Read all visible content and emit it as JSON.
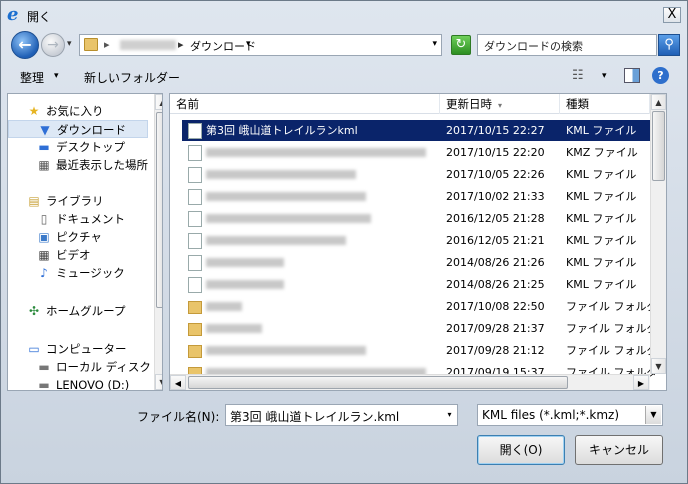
{
  "window": {
    "title": "開く",
    "close_glyph": "X",
    "title_icon_glyph": "e"
  },
  "address": {
    "segment_root_arrow": "▸",
    "segment_current": "ダウンロード",
    "segment_current_arrow": "▾",
    "dropdown_glyph": "▾"
  },
  "search": {
    "placeholder": "ダウンロードの検索"
  },
  "toolbar": {
    "organize_label": "整理",
    "organize_dd": "▾",
    "new_folder_label": "新しいフォルダー",
    "view_dd": "▾",
    "help_glyph": "?"
  },
  "nav": {
    "items": [
      {
        "label": "お気に入り",
        "icon": "star-icon",
        "glyph": "★",
        "color": "#e6b422"
      },
      {
        "label": "ダウンロード",
        "icon": "download-folder-icon",
        "glyph": "▼",
        "color": "#2f6fd6"
      },
      {
        "label": "デスクトップ",
        "icon": "desktop-icon",
        "glyph": "▬",
        "color": "#2f6fd6"
      },
      {
        "label": "最近表示した場所",
        "icon": "recent-places-icon",
        "glyph": "▦",
        "color": "#555"
      },
      {
        "label": "ライブラリ",
        "icon": "library-icon",
        "glyph": "▤",
        "color": "#c9a23a"
      },
      {
        "label": "ドキュメント",
        "icon": "documents-icon",
        "glyph": "▯",
        "color": "#666"
      },
      {
        "label": "ピクチャ",
        "icon": "pictures-icon",
        "glyph": "▣",
        "color": "#3b7ac9"
      },
      {
        "label": "ビデオ",
        "icon": "videos-icon",
        "glyph": "▦",
        "color": "#444"
      },
      {
        "label": "ミュージック",
        "icon": "music-icon",
        "glyph": "♪",
        "color": "#2f6fd6"
      },
      {
        "label": "ホームグループ",
        "icon": "homegroup-icon",
        "glyph": "✣",
        "color": "#2a8a3c"
      },
      {
        "label": "コンピューター",
        "icon": "computer-icon",
        "glyph": "▭",
        "color": "#2f6fd6"
      },
      {
        "label": "ローカル ディスク (C",
        "icon": "local-disk-icon",
        "glyph": "▬",
        "color": "#777"
      },
      {
        "label": "LENOVO (D:)",
        "icon": "drive-icon",
        "glyph": "▬",
        "color": "#777"
      }
    ]
  },
  "files": {
    "columns": {
      "name": "名前",
      "date": "更新日時",
      "type": "種類",
      "sort_arrow": "▾"
    },
    "rows": [
      {
        "name": "第3回 峨山道トレイルランkml",
        "date": "2017/10/15 22:27",
        "type": "KML ファイル"
      },
      {
        "name": "",
        "date": "2017/10/15 22:20",
        "type": "KMZ ファイル"
      },
      {
        "name": "",
        "date": "2017/10/05 22:26",
        "type": "KML ファイル"
      },
      {
        "name": "",
        "date": "2017/10/02 21:33",
        "type": "KML ファイル"
      },
      {
        "name": "",
        "date": "2016/12/05 21:28",
        "type": "KML ファイル"
      },
      {
        "name": "",
        "date": "2016/12/05 21:21",
        "type": "KML ファイル"
      },
      {
        "name": "",
        "date": "2014/08/26 21:26",
        "type": "KML ファイル"
      },
      {
        "name": "",
        "date": "2014/08/26 21:25",
        "type": "KML ファイル"
      },
      {
        "name": "",
        "date": "2017/10/08 22:50",
        "type": "ファイル フォルダー"
      },
      {
        "name": "",
        "date": "2017/09/28 21:37",
        "type": "ファイル フォルダー"
      },
      {
        "name": "",
        "date": "2017/09/28 21:12",
        "type": "ファイル フォルダー"
      },
      {
        "name": "",
        "date": "2017/09/19 15:37",
        "type": "ファイル フォルダー"
      }
    ]
  },
  "scroll": {
    "up": "▲",
    "down": "▼",
    "left": "◀",
    "right": "▶"
  },
  "bottom": {
    "filename_label": "ファイル名(N):",
    "filename_value": "第3回 峨山道トレイルラン.kml",
    "filename_dd": "▾",
    "filter_value": "KML files (*.kml;*.kmz)",
    "filter_dd": "▼",
    "open_label": "開く(O)",
    "cancel_label": "キャンセル"
  }
}
